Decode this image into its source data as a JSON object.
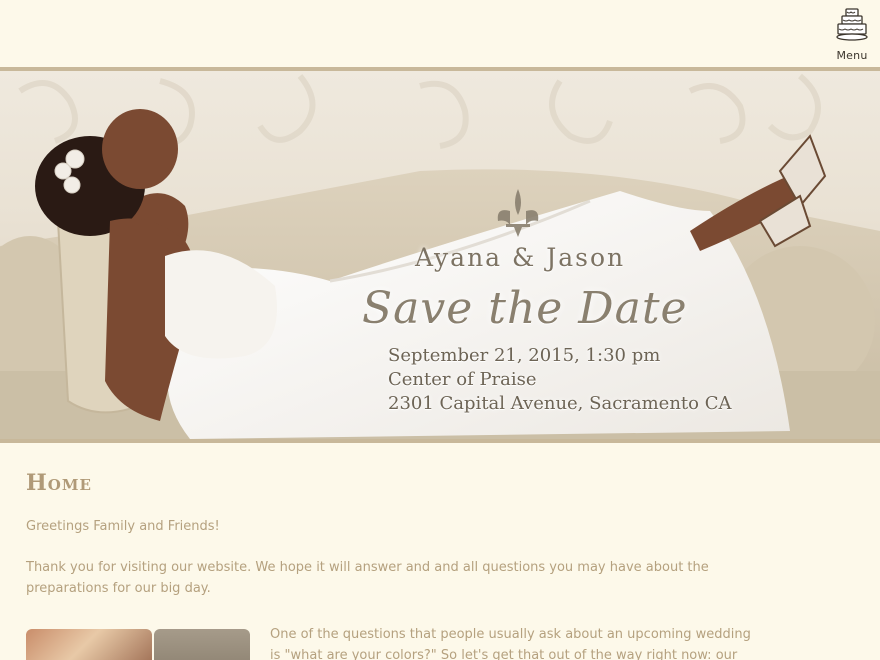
{
  "header": {
    "menu_label": "Menu",
    "menu_icon": "wedding-cake-icon"
  },
  "banner": {
    "couple": "Ayana & Jason",
    "headline": "Save the Date",
    "date_time": "September 21, 2015, 1:30 pm",
    "venue": "Center of Praise",
    "address": "2301 Capital Avenue, Sacramento CA"
  },
  "content": {
    "title": "Home",
    "greeting": "Greetings Family and Friends!",
    "thanks": "Thank you for visiting our website. We hope it will answer and and all questions you may have about the preparations for our big day.",
    "colors_intro": "One of the questions that people usually ask about an upcoming wedding is \"what are your colors?\" So let's get that out of the way right now: our colors are pink and"
  },
  "colors": {
    "background": "#fdf9ea",
    "accent": "#c8b89a",
    "text": "#b5a17f"
  }
}
